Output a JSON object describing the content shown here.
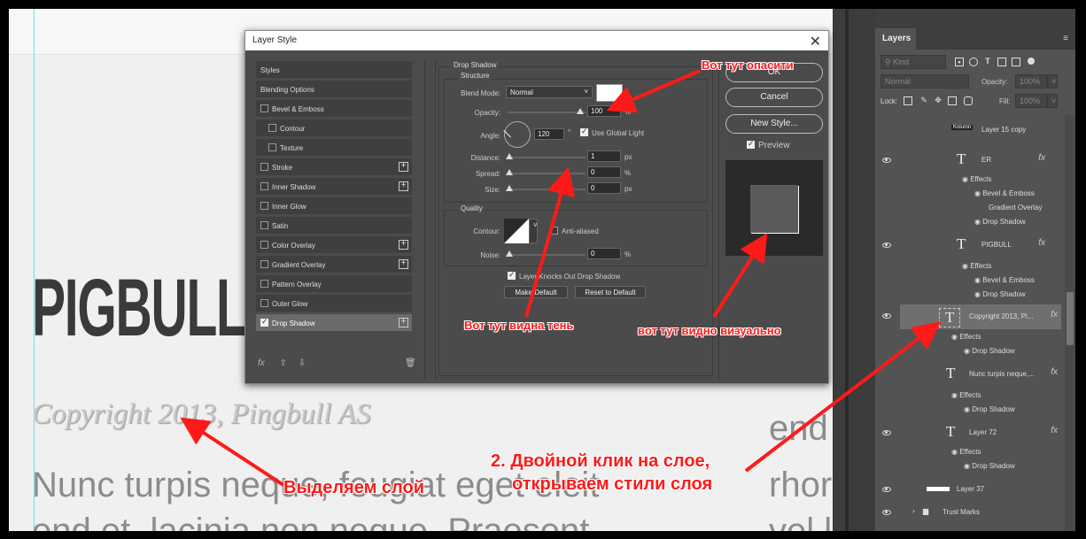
{
  "document": {
    "title": "PIGBULL",
    "copyright": "Copyright 2013, Pingbull AS",
    "body_line1": "Nunc turpis neque, feugiat eget eleit",
    "body_line2": "end et, lacinia non neque. Praesent",
    "right_line1": "end",
    "right_line2": "rhor",
    "right_line3": "vel l"
  },
  "dialog": {
    "title": "Layer Style",
    "close_label": "✕",
    "left_items": [
      {
        "label": "Styles",
        "checkbox": false,
        "plus": false,
        "indent": false,
        "checked": false
      },
      {
        "label": "Blending Options",
        "checkbox": false,
        "plus": false,
        "indent": false,
        "checked": false
      },
      {
        "label": "Bevel & Emboss",
        "checkbox": true,
        "plus": false,
        "indent": false,
        "checked": false
      },
      {
        "label": "Contour",
        "checkbox": true,
        "plus": false,
        "indent": true,
        "checked": false
      },
      {
        "label": "Texture",
        "checkbox": true,
        "plus": false,
        "indent": true,
        "checked": false
      },
      {
        "label": "Stroke",
        "checkbox": true,
        "plus": true,
        "indent": false,
        "checked": false
      },
      {
        "label": "Inner Shadow",
        "checkbox": true,
        "plus": true,
        "indent": false,
        "checked": false
      },
      {
        "label": "Inner Glow",
        "checkbox": true,
        "plus": false,
        "indent": false,
        "checked": false
      },
      {
        "label": "Satin",
        "checkbox": true,
        "plus": false,
        "indent": false,
        "checked": false
      },
      {
        "label": "Color Overlay",
        "checkbox": true,
        "plus": true,
        "indent": false,
        "checked": false
      },
      {
        "label": "Gradient Overlay",
        "checkbox": true,
        "plus": true,
        "indent": false,
        "checked": false
      },
      {
        "label": "Pattern Overlay",
        "checkbox": true,
        "plus": false,
        "indent": false,
        "checked": false
      },
      {
        "label": "Outer Glow",
        "checkbox": true,
        "plus": false,
        "indent": false,
        "checked": false
      },
      {
        "label": "Drop Shadow",
        "checkbox": true,
        "plus": true,
        "indent": false,
        "checked": true
      }
    ],
    "bottom_icons": {
      "fx": "fx",
      "up": "⇧",
      "down": "⇩",
      "trash": "🗑"
    },
    "section_title": "Drop Shadow",
    "structure_label": "Structure",
    "blend_mode_label": "Blend Mode:",
    "blend_mode_value": "Normal",
    "shadow_color": "#ffffff",
    "opacity_label": "Opacity:",
    "opacity_value": "100",
    "opacity_unit": "%",
    "angle_label": "Angle:",
    "angle_value": "120",
    "angle_unit": "°",
    "use_global_light": "Use Global Light",
    "distance_label": "Distance:",
    "distance_value": "1",
    "distance_unit": "px",
    "spread_label": "Spread:",
    "spread_value": "0",
    "spread_unit": "%",
    "size_label": "Size:",
    "size_value": "0",
    "size_unit": "px",
    "quality_label": "Quality",
    "contour_label": "Contour:",
    "anti_aliased": "Anti-aliased",
    "noise_label": "Noise:",
    "noise_value": "0",
    "noise_unit": "%",
    "knocks_out": "Layer Knocks Out Drop Shadow",
    "make_default": "Make Default",
    "reset_default": "Reset to Default",
    "ok_label": "OK",
    "cancel_label": "Cancel",
    "new_style_label": "New Style...",
    "preview_label": "Preview"
  },
  "layers_panel": {
    "tab": "Layers",
    "menu_icon": "≡",
    "kind_placeholder": "Kind",
    "blend_mode": "Normal",
    "opacity_label": "Opacity:",
    "opacity_value": "100%",
    "lock_label": "Lock:",
    "fill_label": "Fill:",
    "fill_value": "100%",
    "layers": [
      {
        "name": "Layer 15 copy",
        "type": "image"
      },
      {
        "name": "ER",
        "type": "text"
      },
      {
        "name": "PIGBULL",
        "type": "text"
      },
      {
        "name": "Copyright 2013, Pi...",
        "type": "text"
      },
      {
        "name": "Nunc turpis neque,...",
        "type": "text"
      },
      {
        "name": "Layer 72",
        "type": "text"
      },
      {
        "name": "Layer 37",
        "type": "image"
      },
      {
        "name": "Trust Marks",
        "type": "group"
      }
    ],
    "effects_label": "Effects",
    "er_effects": [
      "Bevel & Emboss",
      "Gradient Overlay",
      "Drop Shadow"
    ],
    "pigbull_effects": [
      "Bevel & Emboss",
      "Drop Shadow"
    ],
    "drop_shadow": "Drop Shadow",
    "thumb_label": "Kolumn",
    "fx_label": "fx"
  },
  "annotations": {
    "opacity_note": "Вот тут опасити",
    "shadow_note": "Вот тут видна тень",
    "visual_note": "вот тут видно визуально",
    "double_click_line1": "2. Двойной клик на слое,",
    "double_click_line2": "открываем стили слоя",
    "select_layer": "Выделяем слой"
  },
  "colors": {
    "accent_red": "#ff1a1a",
    "panel_bg": "#535353",
    "dialog_bg": "#4b4b4b"
  }
}
